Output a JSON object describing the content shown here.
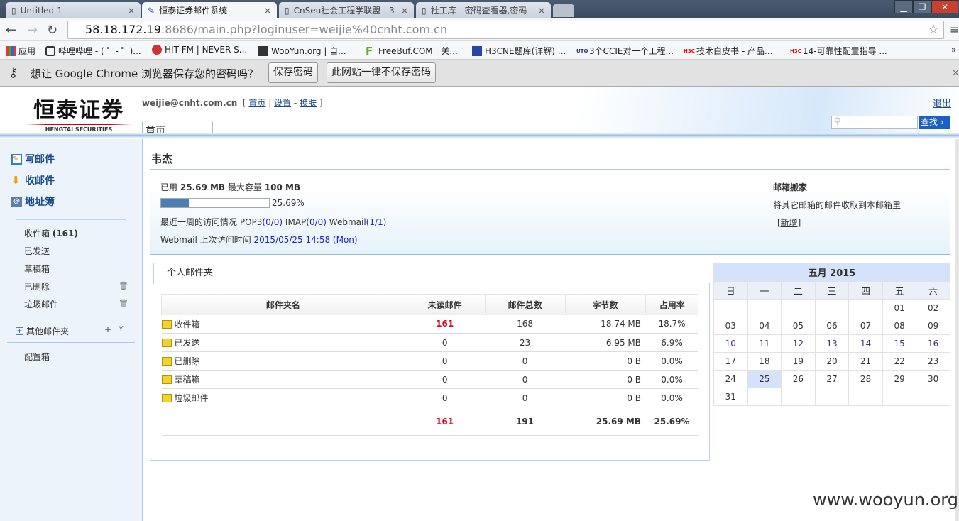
{
  "browser": {
    "tabs": [
      {
        "title": "Untitled-1",
        "active": false
      },
      {
        "title": "恒泰证券邮件系统",
        "active": true
      },
      {
        "title": "CnSeu社会工程学联盟 - 3",
        "active": false
      },
      {
        "title": "社工库 - 密码查看器,密码",
        "active": false
      }
    ],
    "url_host": "58.18.172.19",
    "url_rest": ":8686/main.php?loginuser=weijie%40cnht.com.cn",
    "bookmarks": [
      "应用",
      "哔哩哔哩 - ( ゜- ゜)...",
      "HIT FM | NEVER S...",
      "WooYun.org | 自...",
      "FreeBuf.COM | 关...",
      "H3CNE题库(详解) ...",
      "3个CCIE对一个工程...",
      "技术白皮书 - 产品...",
      "14-可靠性配置指导 ..."
    ],
    "more": "»",
    "password_prompt": "想让 Google Chrome 浏览器保存您的密码吗？",
    "save_password": "保存密码",
    "never_save": "此网站一律不保存密码"
  },
  "header": {
    "logo_cn": "恒泰证券",
    "logo_en": "HENGTAI SECURITIES",
    "user": "weijie@cnht.com.cn",
    "links": [
      "首页",
      "设置",
      "换肤"
    ],
    "logout": "退出",
    "current_tab": "首页",
    "search_button": "查找",
    "search_placeholder": ""
  },
  "sidebar": {
    "compose": "写邮件",
    "receive": "收邮件",
    "addressbook": "地址簿",
    "folders": [
      {
        "name": "收件箱",
        "count": "(161)"
      },
      {
        "name": "已发送"
      },
      {
        "name": "草稿箱"
      },
      {
        "name": "已删除"
      },
      {
        "name": "垃圾邮件"
      }
    ],
    "other_folders": "其他邮件夹",
    "config": "配置箱"
  },
  "main": {
    "username": "韦杰",
    "usage": {
      "used_label": "已用",
      "used": "25.69 MB",
      "max_label": "最大容量",
      "max": "100 MB",
      "percent": "25.69%",
      "fraction": 0.2569
    },
    "access_label": "最近一周的访问情况",
    "pop3": "POP3",
    "pop3_v": "(0/0)",
    "imap": "IMAP",
    "imap_v": "(0/0)",
    "webmail": "Webmail",
    "webmail_v": "(1/1)",
    "last_visit_label": "Webmail 上次访问时间",
    "last_visit": "2015/05/25 14:58 (Mon)",
    "move": {
      "title": "邮箱搬家",
      "desc": "将其它邮箱的邮件收取到本邮箱里",
      "add": "[新增]"
    },
    "folder_tab": "个人邮件夹",
    "table": {
      "headers": [
        "邮件夹名",
        "未读邮件",
        "邮件总数",
        "字节数",
        "占用率"
      ],
      "rows": [
        [
          "收件箱",
          "161",
          "168",
          "18.74 MB",
          "18.7%"
        ],
        [
          "已发送",
          "0",
          "23",
          "6.95 MB",
          "6.9%"
        ],
        [
          "已删除",
          "0",
          "0",
          "0 B",
          "0.0%"
        ],
        [
          "草稿箱",
          "0",
          "0",
          "0 B",
          "0.0%"
        ],
        [
          "垃圾邮件",
          "0",
          "0",
          "0 B",
          "0.0%"
        ]
      ],
      "total": [
        "161",
        "191",
        "25.69 MB",
        "25.69%"
      ]
    }
  },
  "calendar": {
    "title": "五月  2015",
    "weekdays": [
      "日",
      "一",
      "二",
      "三",
      "四",
      "五",
      "六"
    ],
    "weeks": [
      [
        "",
        "",
        "",
        "",
        "",
        "01",
        "02"
      ],
      [
        "03",
        "04",
        "05",
        "06",
        "07",
        "08",
        "09"
      ],
      [
        "10",
        "11",
        "12",
        "13",
        "14",
        "15",
        "16"
      ],
      [
        "17",
        "18",
        "19",
        "20",
        "21",
        "22",
        "23"
      ],
      [
        "24",
        "25",
        "26",
        "27",
        "28",
        "29",
        "30"
      ],
      [
        "31",
        "",
        "",
        "",
        "",
        "",
        ""
      ]
    ],
    "today": "25"
  },
  "watermark": "www.wooyun.org",
  "colors": {
    "link": "#1b4c8a",
    "unread": "#e0001a",
    "accent": "#1f5fbf"
  }
}
